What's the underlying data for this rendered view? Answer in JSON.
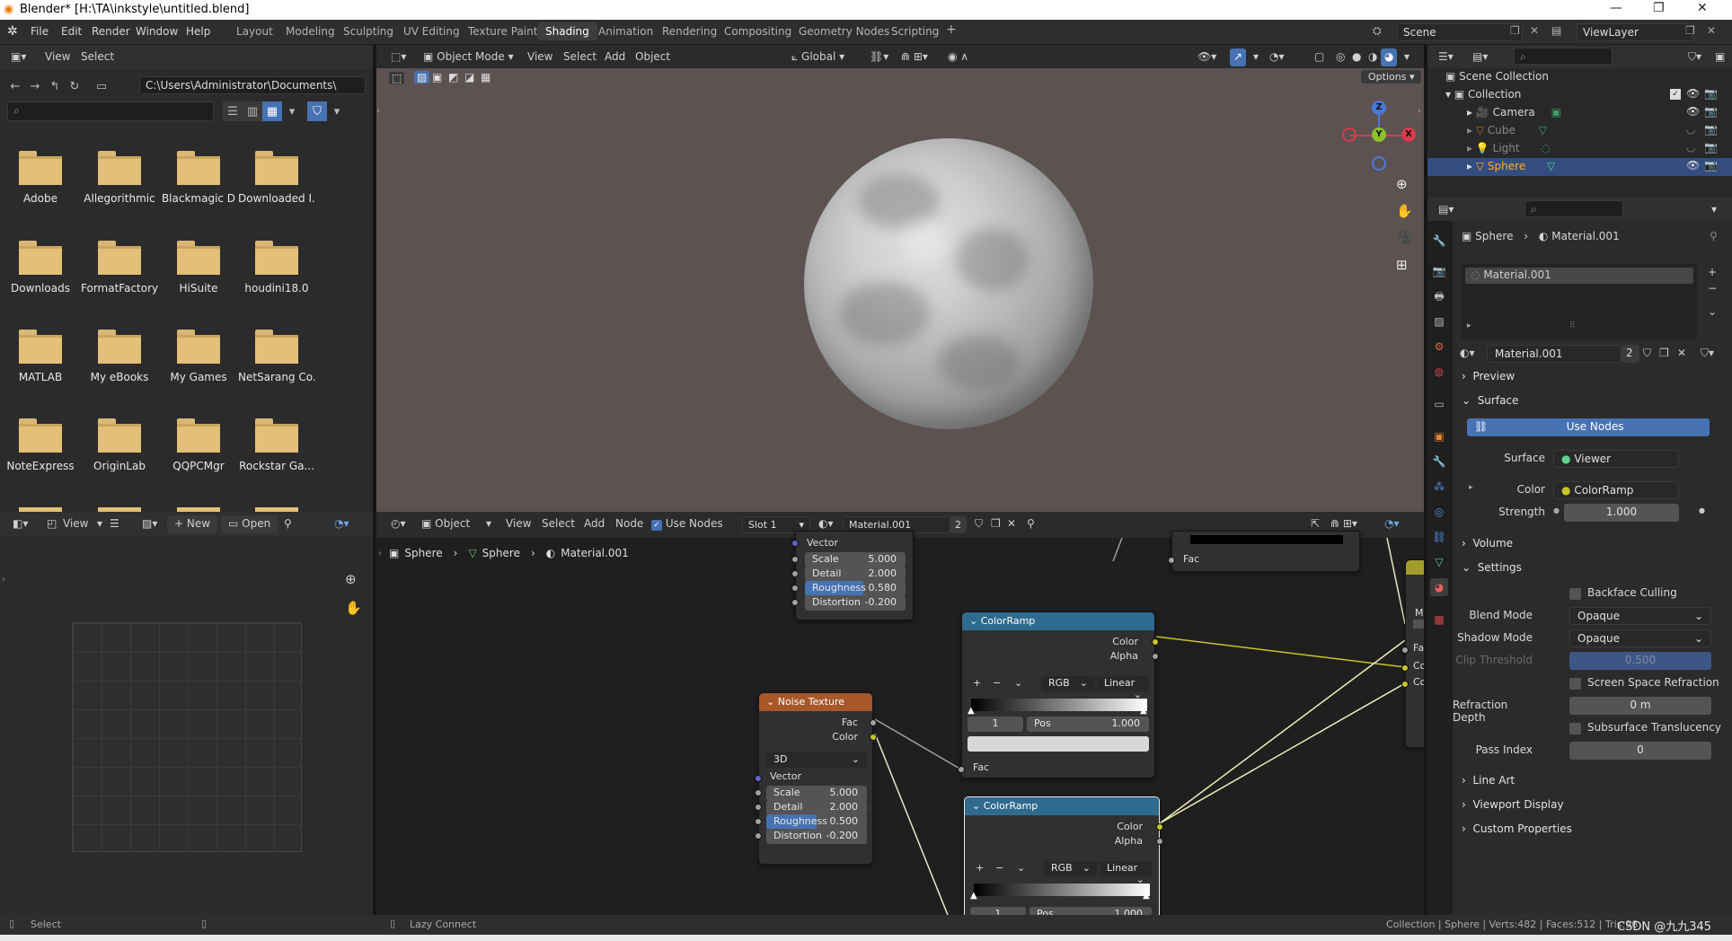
{
  "window": {
    "title": "Blender* [H:\\TA\\inkstyle\\untitled.blend]"
  },
  "menubar": {
    "items": [
      "File",
      "Edit",
      "Render",
      "Window",
      "Help"
    ]
  },
  "workspaces": [
    "Layout",
    "Modeling",
    "Sculpting",
    "UV Editing",
    "Texture Paint",
    "Shading",
    "Animation",
    "Rendering",
    "Compositing",
    "Geometry Nodes",
    "Scripting"
  ],
  "active_workspace": "Shading",
  "scene": {
    "name": "Scene",
    "view_layer": "ViewLayer"
  },
  "file_browser": {
    "header": {
      "view": "View",
      "select": "Select"
    },
    "path": "C:\\Users\\Administrator\\Documents\\",
    "folders": [
      "Adobe",
      "Allegorithmic",
      "Blackmagic D",
      "Downloaded I...",
      "Downloads",
      "FormatFactory",
      "HiSuite",
      "houdini18.0",
      "MATLAB",
      "My eBooks",
      "My Games",
      "NetSarang Co...",
      "NoteExpress",
      "OriginLab",
      "QQPCMgr",
      "Rockstar Ga..."
    ]
  },
  "image_editor": {
    "view": "View",
    "new": "New",
    "open": "Open"
  },
  "viewport": {
    "mode": "Object Mode",
    "menus": [
      "View",
      "Select",
      "Add",
      "Object"
    ],
    "orientation": "Global",
    "options": "Options",
    "gizmo": {
      "z": "Z",
      "y": "Y",
      "x": "X"
    }
  },
  "node_editor": {
    "object": "Object",
    "menus": [
      "View",
      "Select",
      "Add",
      "Node"
    ],
    "use_nodes": "Use Nodes",
    "slot": "Slot 1",
    "material": "Material.001",
    "users": "2",
    "breadcrumb": [
      "Sphere",
      "Sphere",
      "Material.001"
    ],
    "top_node": {
      "vector": "Vector",
      "params": [
        {
          "label": "Scale",
          "value": "5.000"
        },
        {
          "label": "Detail",
          "value": "2.000"
        },
        {
          "label": "Roughness",
          "value": "0.580"
        },
        {
          "label": "Distortion",
          "value": "-0.200"
        }
      ]
    },
    "top_right_fac": "Fac",
    "noise_texture": {
      "title": "Noise Texture",
      "fac": "Fac",
      "color": "Color",
      "dimensions": "3D",
      "vector": "Vector",
      "params": [
        {
          "label": "Scale",
          "value": "5.000"
        },
        {
          "label": "Detail",
          "value": "2.000"
        },
        {
          "label": "Roughness",
          "value": "0.500"
        },
        {
          "label": "Distortion",
          "value": "-0.200"
        }
      ]
    },
    "colorramp1": {
      "title": "ColorRamp",
      "color": "Color",
      "alpha": "Alpha",
      "mode": "RGB",
      "interp": "Linear",
      "index": "1",
      "pos_label": "Pos",
      "pos_value": "1.000",
      "fac": "Fac"
    },
    "colorramp2": {
      "title": "ColorRamp",
      "color": "Color",
      "alpha": "Alpha",
      "mode": "RGB",
      "interp": "Linear",
      "index": "1",
      "pos_label": "Pos",
      "pos_value": "1.000"
    },
    "edge_labels": [
      "Fa",
      "Co",
      "Co",
      "M"
    ]
  },
  "outliner": {
    "scene_collection": "Scene Collection",
    "collection": "Collection",
    "items": [
      "Camera",
      "Cube",
      "Light",
      "Sphere"
    ]
  },
  "properties": {
    "breadcrumb": [
      "Sphere",
      "Material.001"
    ],
    "slot_material": "Material.001",
    "material": "Material.001",
    "users": "2",
    "sections": {
      "preview": "Preview",
      "surface": "Surface",
      "volume": "Volume",
      "settings": "Settings",
      "line_art": "Line Art",
      "viewport_display": "Viewport Display",
      "custom_properties": "Custom Properties"
    },
    "use_nodes_button": "Use Nodes",
    "surface": {
      "label": "Surface",
      "value": "Viewer"
    },
    "color": {
      "label": "Color",
      "value": "ColorRamp"
    },
    "strength": {
      "label": "Strength",
      "value": "1.000"
    },
    "backface_culling": "Backface Culling",
    "blend_mode": {
      "label": "Blend Mode",
      "value": "Opaque"
    },
    "shadow_mode": {
      "label": "Shadow Mode",
      "value": "Opaque"
    },
    "clip_threshold": {
      "label": "Clip Threshold",
      "value": "0.500"
    },
    "screen_space_refraction": "Screen Space Refraction",
    "refraction_depth": {
      "label": "Refraction Depth",
      "value": "0 m"
    },
    "subsurface_translucency": "Subsurface Translucency",
    "pass_index": {
      "label": "Pass Index",
      "value": "0"
    }
  },
  "statusbar": {
    "left": "Select",
    "mid": "Lazy Connect",
    "right": "Collection | Sphere | Verts:482 | Faces:512 | Tris:96",
    "watermark": "CSDN @九九345"
  },
  "colors": {
    "accent": "#4772b3",
    "noise_header": "#a8572a",
    "ramp_header": "#2f6b8f",
    "socket_yellow": "#c7c729",
    "socket_gray": "#a1a1a1",
    "socket_blue": "#6363c7"
  }
}
